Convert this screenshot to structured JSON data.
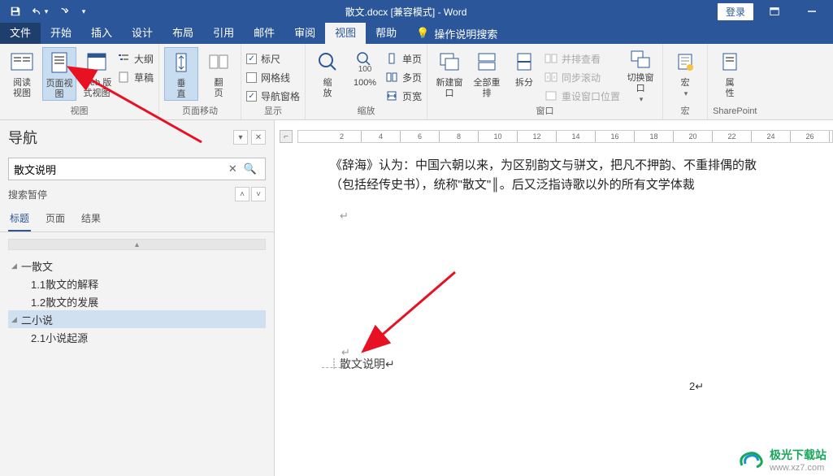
{
  "titlebar": {
    "doc_title": "散文.docx [兼容模式] - Word",
    "login": "登录"
  },
  "menu": {
    "file": "文件",
    "home": "开始",
    "insert": "插入",
    "design": "设计",
    "layout": "布局",
    "references": "引用",
    "mailings": "邮件",
    "review": "审阅",
    "view": "视图",
    "help": "帮助",
    "tell_me": "操作说明搜索"
  },
  "ribbon": {
    "views": {
      "read": "阅读\n视图",
      "print": "页面视图",
      "web": "Web 版式视图",
      "outline": "大纲",
      "draft": "草稿",
      "group": "视图"
    },
    "page_move": {
      "vertical": "垂\n直",
      "side": "翻\n页",
      "group": "页面移动"
    },
    "show": {
      "ruler": "标尺",
      "grid": "网格线",
      "nav": "导航窗格",
      "group": "显示"
    },
    "zoom": {
      "zoom": "缩\n放",
      "hundred": "100%",
      "one_page": "单页",
      "multi_page": "多页",
      "page_width": "页宽",
      "group": "缩放"
    },
    "window": {
      "new": "新建窗口",
      "arrange": "全部重排",
      "split": "拆分",
      "side_by_side": "并排查看",
      "sync_scroll": "同步滚动",
      "reset_pos": "重设窗口位置",
      "switch": "切换窗口",
      "group": "窗口"
    },
    "macros": {
      "macros": "宏",
      "group": "宏"
    },
    "sharepoint": {
      "props": "属\n性",
      "group": "SharePoint"
    }
  },
  "nav": {
    "title": "导航",
    "search_value": "散文说明",
    "pause": "搜索暂停",
    "tabs": {
      "headings": "标题",
      "pages": "页面",
      "results": "结果"
    },
    "tree": [
      {
        "label": "一散文",
        "lvl": 1
      },
      {
        "label": "1.1散文的解释",
        "lvl": 2
      },
      {
        "label": "1.2散文的发展",
        "lvl": 2
      },
      {
        "label": "二小说",
        "lvl": 1,
        "sel": true
      },
      {
        "label": "2.1小说起源",
        "lvl": 2
      }
    ]
  },
  "doc": {
    "line1": "《辞海》认为：中国六朝以来，为区别韵文与骈文，把凡不押韵、不重排偶的散",
    "line2": "（包括经传史书），统称\"散文\"║。后又泛指诗歌以外的所有文学体裁",
    "footer_text": "散文说明",
    "page_num": "2"
  },
  "watermark": {
    "name": "极光下载站",
    "url": "www.xz7.com"
  }
}
